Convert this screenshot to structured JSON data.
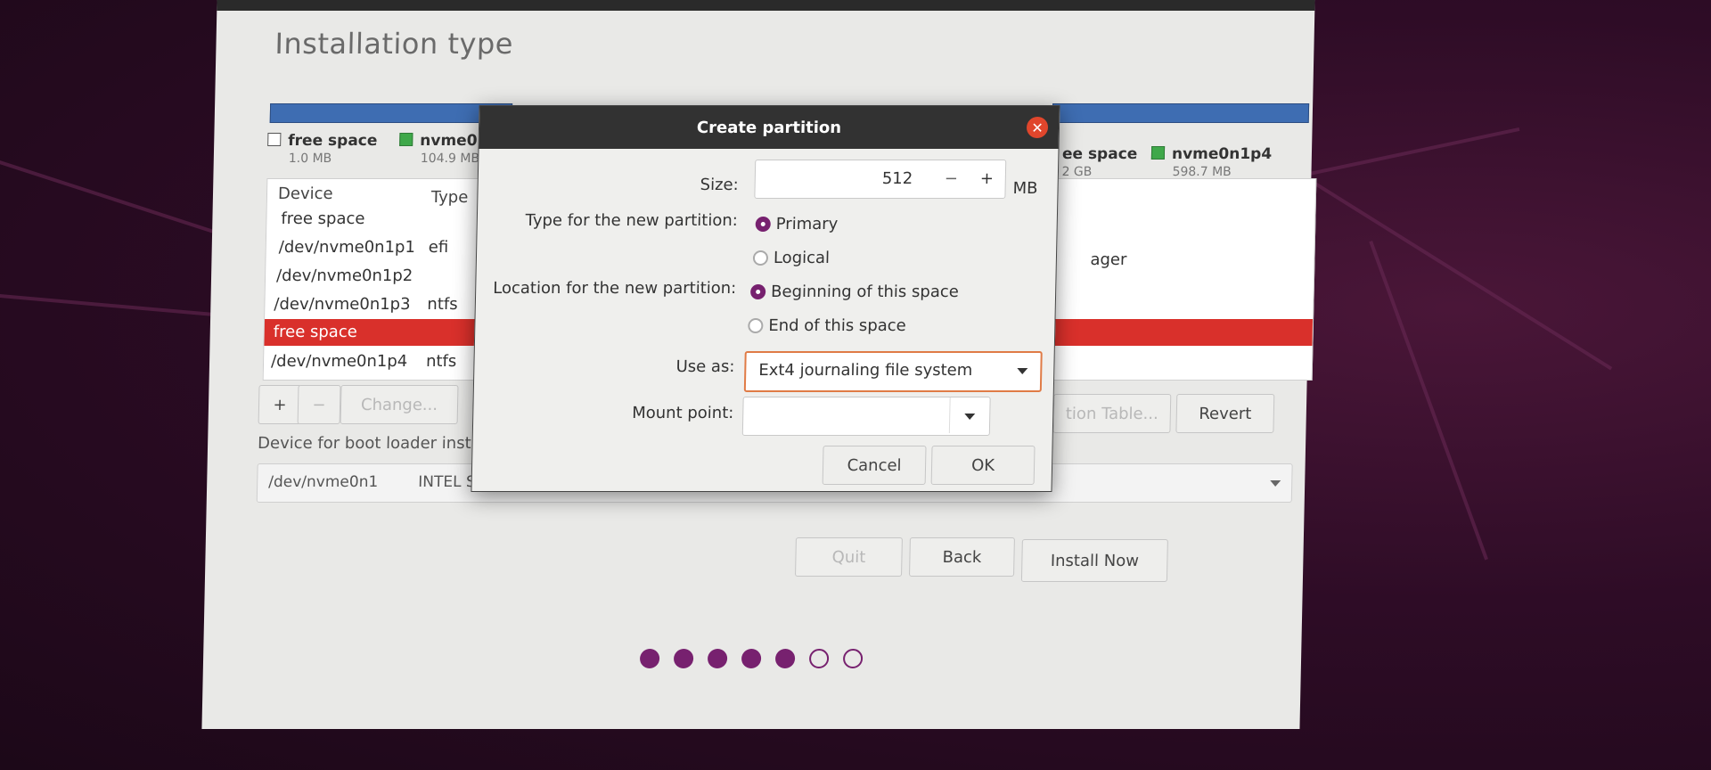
{
  "installer": {
    "title": "Installation type",
    "legend": [
      {
        "name": "free space",
        "size": "1.0 MB",
        "color": "#ffffff"
      },
      {
        "name": "nvme0n",
        "size": "104.9 MB",
        "color": "#3fa84a"
      },
      {
        "name": "ee space",
        "size": "2 GB",
        "color": "#ffffff"
      },
      {
        "name": "nvme0n1p4",
        "size": "598.7 MB",
        "color": "#3fa84a"
      }
    ],
    "table": {
      "headers": [
        "Device",
        "Type"
      ],
      "rows": [
        {
          "device": "free space",
          "type": ""
        },
        {
          "device": "/dev/nvme0n1p1",
          "type": "efi"
        },
        {
          "device": "/dev/nvme0n1p2",
          "type": ""
        },
        {
          "device": "/dev/nvme0n1p3",
          "type": "ntfs"
        },
        {
          "device": "free space",
          "type": "",
          "selected": true
        },
        {
          "device": "/dev/nvme0n1p4",
          "type": "ntfs"
        }
      ],
      "right_fragment": "ager"
    },
    "buttons": {
      "add": "+",
      "remove": "−",
      "change": "Change...",
      "new_table": "tion Table...",
      "revert": "Revert"
    },
    "boot_loader_label": "Device for boot loader inst",
    "boot_loader_device": "/dev/nvme0n1",
    "boot_loader_model": "INTEL S",
    "nav": {
      "quit": "Quit",
      "back": "Back",
      "install": "Install Now"
    },
    "progress": {
      "done": 5,
      "total": 7
    }
  },
  "dialog": {
    "title": "Create partition",
    "size_label": "Size:",
    "size_value": "512",
    "size_minus": "−",
    "size_plus": "+",
    "size_unit": "MB",
    "type_label": "Type for the new partition:",
    "type_primary": "Primary",
    "type_logical": "Logical",
    "location_label": "Location for the new partition:",
    "location_begin": "Beginning of this space",
    "location_end": "End of this space",
    "useas_label": "Use as:",
    "useas_value": "Ext4 journaling file system",
    "mount_label": "Mount point:",
    "mount_value": "",
    "cancel": "Cancel",
    "ok": "OK",
    "accent": "#77216f",
    "close_color": "#e0462c"
  }
}
